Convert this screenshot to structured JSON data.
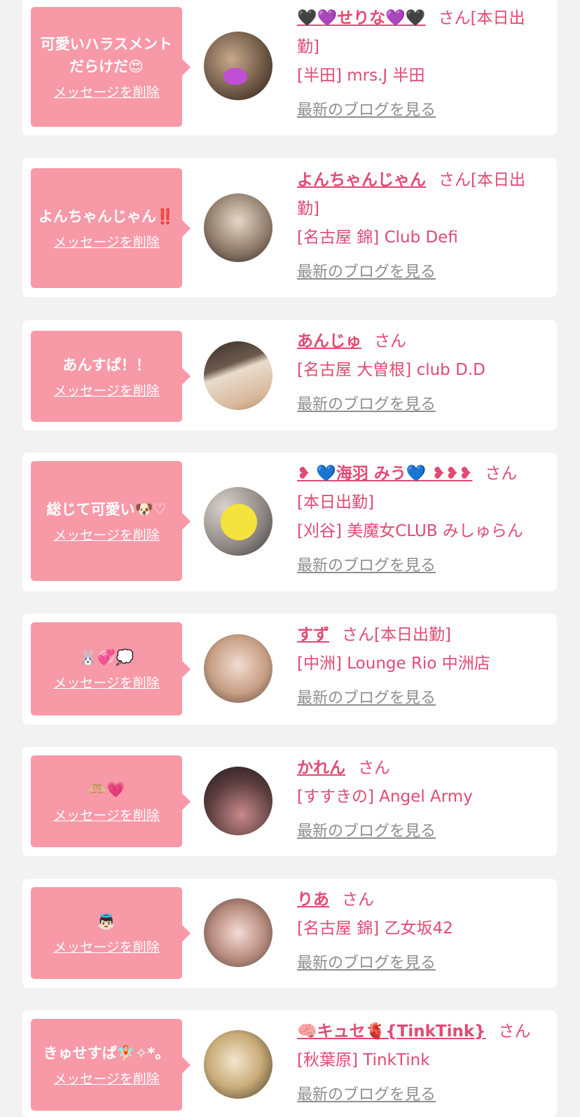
{
  "common": {
    "delete_label": "メッセージを削除",
    "blog_label": "最新のブログを見る",
    "san": "さん"
  },
  "items": [
    {
      "message": "可愛いハラスメントだらけだ😍",
      "name": "🖤💜せりな💜🖤",
      "status": "[本日出勤]",
      "shop": "[半田] mrs.J 半田"
    },
    {
      "message": "よんちゃんじゃん‼️",
      "name": "よんちゃんじゃん",
      "status": "[本日出勤]",
      "shop": "[名古屋 錦] Club Defi"
    },
    {
      "message": "あんすぱ！！",
      "name": "あんじゅ",
      "status": "",
      "shop": "[名古屋 大曽根] club D.D"
    },
    {
      "message": "総じて可愛い🐶♡",
      "name": "❥ 💙海羽 みう💙 ❥❥❥",
      "status": "[本日出勤]",
      "shop": "[刈谷] 美魔女CLUB みしゅらん"
    },
    {
      "message": "🐰💞💭",
      "name": "すず",
      "status": "[本日出勤]",
      "shop": "[中洲] Lounge Rio 中洲店"
    },
    {
      "message": "🫶🏼💗",
      "name": "かれん",
      "status": "",
      "shop": "[すすきの] Angel Army"
    },
    {
      "message": "👼🏻",
      "name": "りあ",
      "status": "",
      "shop": "[名古屋 錦] 乙女坂42"
    },
    {
      "message": "きゅせすぱ🧚🏻✧*。",
      "name": "🧠キュセ🫀{TinkTink}",
      "status": "",
      "shop": "[秋葉原] TinkTink"
    }
  ]
}
